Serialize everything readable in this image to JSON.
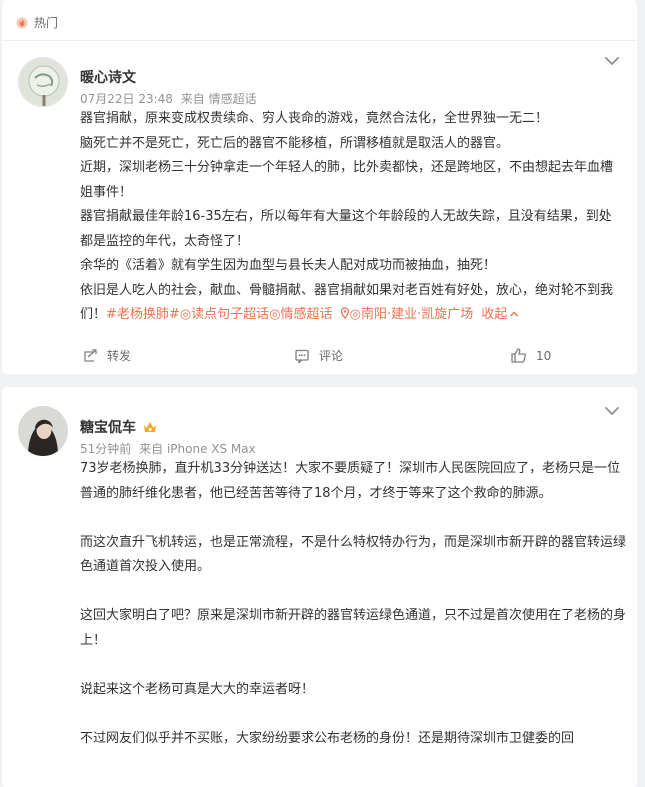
{
  "feed": {
    "hot_label": "热门",
    "posts": [
      {
        "author": "暖心诗文",
        "time": "07月22日 23:48",
        "source_prefix": "来自",
        "source": "情感超话",
        "lines": [
          "器官捐献，原来变成权贵续命、穷人丧命的游戏，竟然合法化，全世界独一无二！",
          "脑死亡并不是死亡，死亡后的器官不能移植，所谓移植就是取活人的器官。",
          "近期，深圳老杨三十分钟拿走一个年轻人的肺，比外卖都快，还是跨地区，不由想起去年血槽姐事件！",
          "器官捐献最佳年龄16-35左右，所以每年有大量这个年龄段的人无故失踪，且没有结果，到处都是监控的年代，太奇怪了！",
          "余华的《活着》就有学生因为血型与县长夫人配对成功而被抽血，抽死！",
          "依旧是人吃人的社会，献血、骨髓捐献、器官捐献如果对老百姓有好处，放心，绝对轮不到我们！"
        ],
        "tags": [
          "#老杨换肺#",
          "◎读点句子超话",
          "◎情感超话",
          "◎南阳·建业·凯旋广场",
          "收起"
        ],
        "actions": {
          "repost": "转发",
          "comment": "评论",
          "like_count": "10"
        }
      },
      {
        "author": "糖宝侃车",
        "time": "51分钟前",
        "source_prefix": "来自",
        "source": "iPhone XS Max",
        "paragraphs": [
          "73岁老杨换肺，直升机33分钟送达！大家不要质疑了！深圳市人民医院回应了，老杨只是一位普通的肺纤维化患者，他已经苦苦等待了18个月，才终于等来了这个救命的肺源。",
          "而这次直升飞机转运，也是正常流程，不是什么特权特办行为，而是深圳市新开辟的器官转运绿色通道首次投入使用。",
          "这回大家明白了吧？原来是深圳市新开辟的器官转运绿色通道，只不过是首次使用在了老杨的身上！",
          "说起来这个老杨可真是大大的幸运者呀！",
          "不过网友们似乎并不买账，大家纷纷要求公布老杨的身份！还是期待深圳市卫健委的回"
        ]
      }
    ],
    "colors": {
      "accent": "#eb7350",
      "muted": "#939393"
    },
    "icons": [
      "fire-icon",
      "chevron-down-icon",
      "repost-icon",
      "comment-icon",
      "like-icon",
      "location-icon",
      "verified-badge-icon"
    ]
  }
}
